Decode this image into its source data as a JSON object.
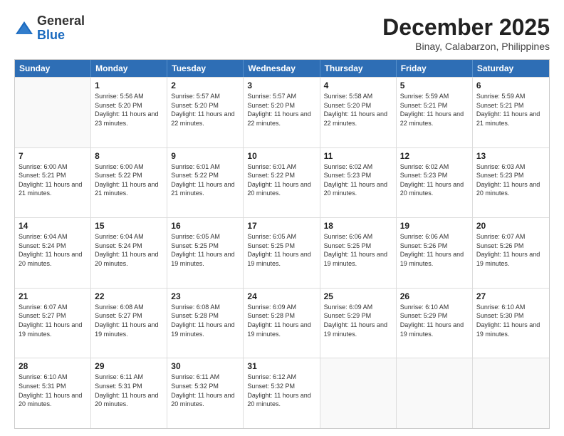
{
  "header": {
    "logo_general": "General",
    "logo_blue": "Blue",
    "month_title": "December 2025",
    "location": "Binay, Calabarzon, Philippines"
  },
  "weekdays": [
    "Sunday",
    "Monday",
    "Tuesday",
    "Wednesday",
    "Thursday",
    "Friday",
    "Saturday"
  ],
  "weeks": [
    [
      {
        "day": "",
        "empty": true
      },
      {
        "day": "1",
        "sunrise": "5:56 AM",
        "sunset": "5:20 PM",
        "daylight": "11 hours and 23 minutes."
      },
      {
        "day": "2",
        "sunrise": "5:57 AM",
        "sunset": "5:20 PM",
        "daylight": "11 hours and 22 minutes."
      },
      {
        "day": "3",
        "sunrise": "5:57 AM",
        "sunset": "5:20 PM",
        "daylight": "11 hours and 22 minutes."
      },
      {
        "day": "4",
        "sunrise": "5:58 AM",
        "sunset": "5:20 PM",
        "daylight": "11 hours and 22 minutes."
      },
      {
        "day": "5",
        "sunrise": "5:59 AM",
        "sunset": "5:21 PM",
        "daylight": "11 hours and 22 minutes."
      },
      {
        "day": "6",
        "sunrise": "5:59 AM",
        "sunset": "5:21 PM",
        "daylight": "11 hours and 21 minutes."
      }
    ],
    [
      {
        "day": "7",
        "sunrise": "6:00 AM",
        "sunset": "5:21 PM",
        "daylight": "11 hours and 21 minutes."
      },
      {
        "day": "8",
        "sunrise": "6:00 AM",
        "sunset": "5:22 PM",
        "daylight": "11 hours and 21 minutes."
      },
      {
        "day": "9",
        "sunrise": "6:01 AM",
        "sunset": "5:22 PM",
        "daylight": "11 hours and 21 minutes."
      },
      {
        "day": "10",
        "sunrise": "6:01 AM",
        "sunset": "5:22 PM",
        "daylight": "11 hours and 20 minutes."
      },
      {
        "day": "11",
        "sunrise": "6:02 AM",
        "sunset": "5:23 PM",
        "daylight": "11 hours and 20 minutes."
      },
      {
        "day": "12",
        "sunrise": "6:02 AM",
        "sunset": "5:23 PM",
        "daylight": "11 hours and 20 minutes."
      },
      {
        "day": "13",
        "sunrise": "6:03 AM",
        "sunset": "5:23 PM",
        "daylight": "11 hours and 20 minutes."
      }
    ],
    [
      {
        "day": "14",
        "sunrise": "6:04 AM",
        "sunset": "5:24 PM",
        "daylight": "11 hours and 20 minutes."
      },
      {
        "day": "15",
        "sunrise": "6:04 AM",
        "sunset": "5:24 PM",
        "daylight": "11 hours and 20 minutes."
      },
      {
        "day": "16",
        "sunrise": "6:05 AM",
        "sunset": "5:25 PM",
        "daylight": "11 hours and 19 minutes."
      },
      {
        "day": "17",
        "sunrise": "6:05 AM",
        "sunset": "5:25 PM",
        "daylight": "11 hours and 19 minutes."
      },
      {
        "day": "18",
        "sunrise": "6:06 AM",
        "sunset": "5:25 PM",
        "daylight": "11 hours and 19 minutes."
      },
      {
        "day": "19",
        "sunrise": "6:06 AM",
        "sunset": "5:26 PM",
        "daylight": "11 hours and 19 minutes."
      },
      {
        "day": "20",
        "sunrise": "6:07 AM",
        "sunset": "5:26 PM",
        "daylight": "11 hours and 19 minutes."
      }
    ],
    [
      {
        "day": "21",
        "sunrise": "6:07 AM",
        "sunset": "5:27 PM",
        "daylight": "11 hours and 19 minutes."
      },
      {
        "day": "22",
        "sunrise": "6:08 AM",
        "sunset": "5:27 PM",
        "daylight": "11 hours and 19 minutes."
      },
      {
        "day": "23",
        "sunrise": "6:08 AM",
        "sunset": "5:28 PM",
        "daylight": "11 hours and 19 minutes."
      },
      {
        "day": "24",
        "sunrise": "6:09 AM",
        "sunset": "5:28 PM",
        "daylight": "11 hours and 19 minutes."
      },
      {
        "day": "25",
        "sunrise": "6:09 AM",
        "sunset": "5:29 PM",
        "daylight": "11 hours and 19 minutes."
      },
      {
        "day": "26",
        "sunrise": "6:10 AM",
        "sunset": "5:29 PM",
        "daylight": "11 hours and 19 minutes."
      },
      {
        "day": "27",
        "sunrise": "6:10 AM",
        "sunset": "5:30 PM",
        "daylight": "11 hours and 19 minutes."
      }
    ],
    [
      {
        "day": "28",
        "sunrise": "6:10 AM",
        "sunset": "5:31 PM",
        "daylight": "11 hours and 20 minutes."
      },
      {
        "day": "29",
        "sunrise": "6:11 AM",
        "sunset": "5:31 PM",
        "daylight": "11 hours and 20 minutes."
      },
      {
        "day": "30",
        "sunrise": "6:11 AM",
        "sunset": "5:32 PM",
        "daylight": "11 hours and 20 minutes."
      },
      {
        "day": "31",
        "sunrise": "6:12 AM",
        "sunset": "5:32 PM",
        "daylight": "11 hours and 20 minutes."
      },
      {
        "day": "",
        "empty": true
      },
      {
        "day": "",
        "empty": true
      },
      {
        "day": "",
        "empty": true
      }
    ]
  ]
}
